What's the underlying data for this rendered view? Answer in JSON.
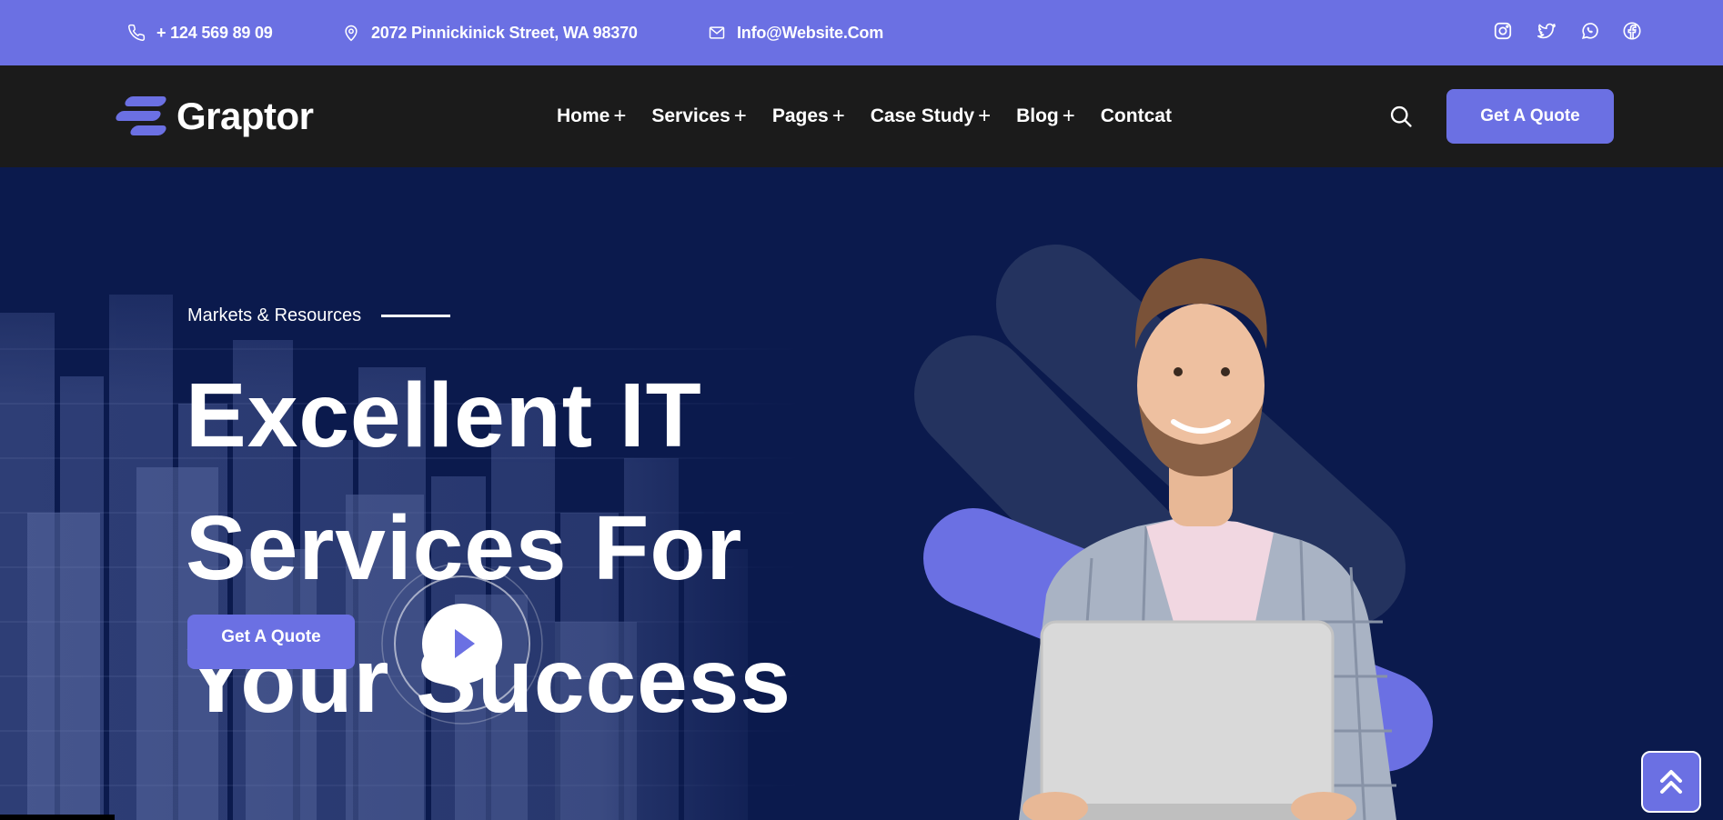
{
  "topbar": {
    "phone": "+ 124 569 89 09",
    "address": "2072 Pinnickinick Street, WA 98370",
    "email": "Info@Website.Com",
    "social": [
      "instagram-icon",
      "twitter-icon",
      "whatsapp-icon",
      "facebook-icon"
    ]
  },
  "navbar": {
    "logo_text": "Graptor",
    "menu": [
      {
        "label": "Home",
        "has_submenu": true
      },
      {
        "label": "Services",
        "has_submenu": true
      },
      {
        "label": "Pages",
        "has_submenu": true
      },
      {
        "label": "Case Study",
        "has_submenu": true
      },
      {
        "label": "Blog",
        "has_submenu": true
      },
      {
        "label": "Contcat",
        "has_submenu": false
      }
    ],
    "submenu_indicator": "+",
    "cta_label": "Get A Quote"
  },
  "hero": {
    "eyebrow": "Markets & Resources",
    "headline_lines": [
      "Excellent IT",
      "Services For",
      "Your Success"
    ],
    "cta_label": "Get A Quote"
  },
  "colors": {
    "accent": "#6b70e3",
    "topbar_bg": "#6b70e3",
    "navbar_bg": "#1b1b1b",
    "hero_bg": "#0b1a4d",
    "text": "#ffffff"
  }
}
